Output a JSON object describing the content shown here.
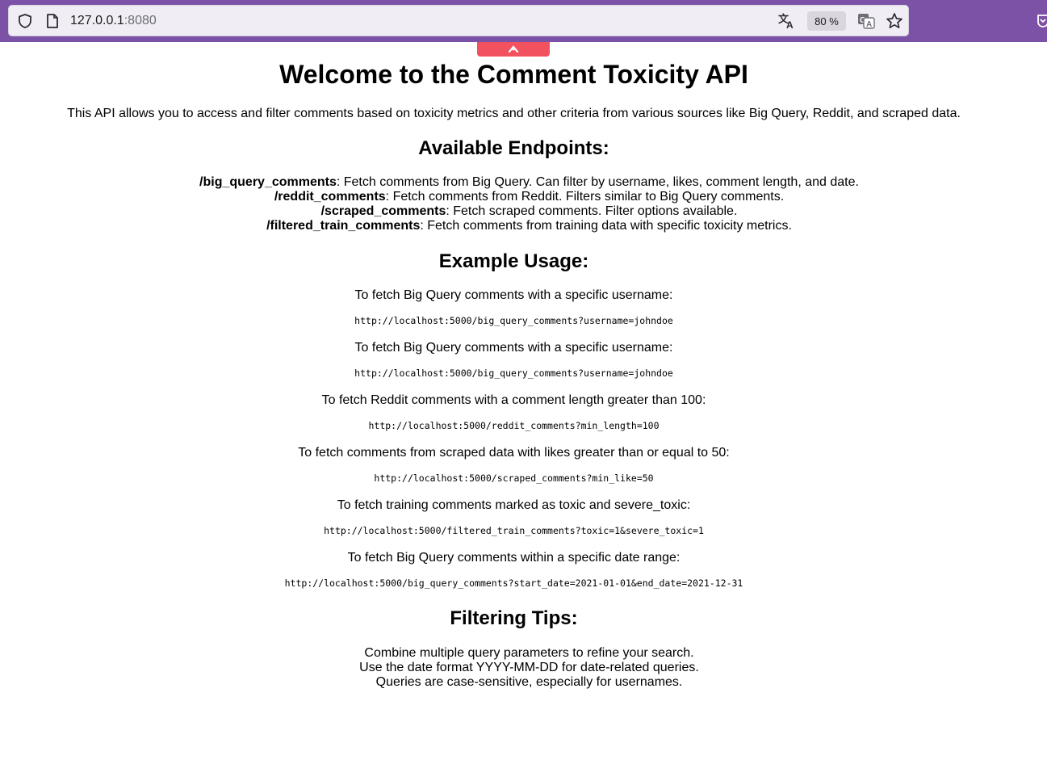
{
  "browser": {
    "url_host": "127.0.0.1",
    "url_port": ":8080",
    "zoom": "80 %",
    "chrome_color": "#7b52a6",
    "tab_accent_color": "#f25160",
    "icons": [
      "shield-icon",
      "page-icon",
      "translate-icon",
      "reader-translate-icon",
      "star-icon",
      "pocket-icon",
      "tab-arrow-icon"
    ]
  },
  "page": {
    "title": "Welcome to the Comment Toxicity API",
    "intro": "This API allows you to access and filter comments based on toxicity metrics and other criteria from various sources like Big Query, Reddit, and scraped data.",
    "endpoints_heading": "Available Endpoints:",
    "endpoints": [
      {
        "path": "/big_query_comments",
        "desc": ": Fetch comments from Big Query. Can filter by username, likes, comment length, and date."
      },
      {
        "path": "/reddit_comments",
        "desc": ": Fetch comments from Reddit. Filters similar to Big Query comments."
      },
      {
        "path": "/scraped_comments",
        "desc": ": Fetch scraped comments. Filter options available."
      },
      {
        "path": "/filtered_train_comments",
        "desc": ": Fetch comments from training data with specific toxicity metrics."
      }
    ],
    "examples_heading": "Example Usage:",
    "examples": [
      {
        "desc": "To fetch Big Query comments with a specific username:",
        "code": "http://localhost:5000/big_query_comments?username=johndoe"
      },
      {
        "desc": "To fetch Big Query comments with a specific username:",
        "code": "http://localhost:5000/big_query_comments?username=johndoe"
      },
      {
        "desc": "To fetch Reddit comments with a comment length greater than 100:",
        "code": "http://localhost:5000/reddit_comments?min_length=100"
      },
      {
        "desc": "To fetch comments from scraped data with likes greater than or equal to 50:",
        "code": "http://localhost:5000/scraped_comments?min_like=50"
      },
      {
        "desc": "To fetch training comments marked as toxic and severe_toxic:",
        "code": "http://localhost:5000/filtered_train_comments?toxic=1&severe_toxic=1"
      },
      {
        "desc": "To fetch Big Query comments within a specific date range:",
        "code": "http://localhost:5000/big_query_comments?start_date=2021-01-01&end_date=2021-12-31"
      }
    ],
    "tips_heading": "Filtering Tips:",
    "tips": [
      "Combine multiple query parameters to refine your search.",
      "Use the date format YYYY-MM-DD for date-related queries.",
      "Queries are case-sensitive, especially for usernames."
    ]
  }
}
